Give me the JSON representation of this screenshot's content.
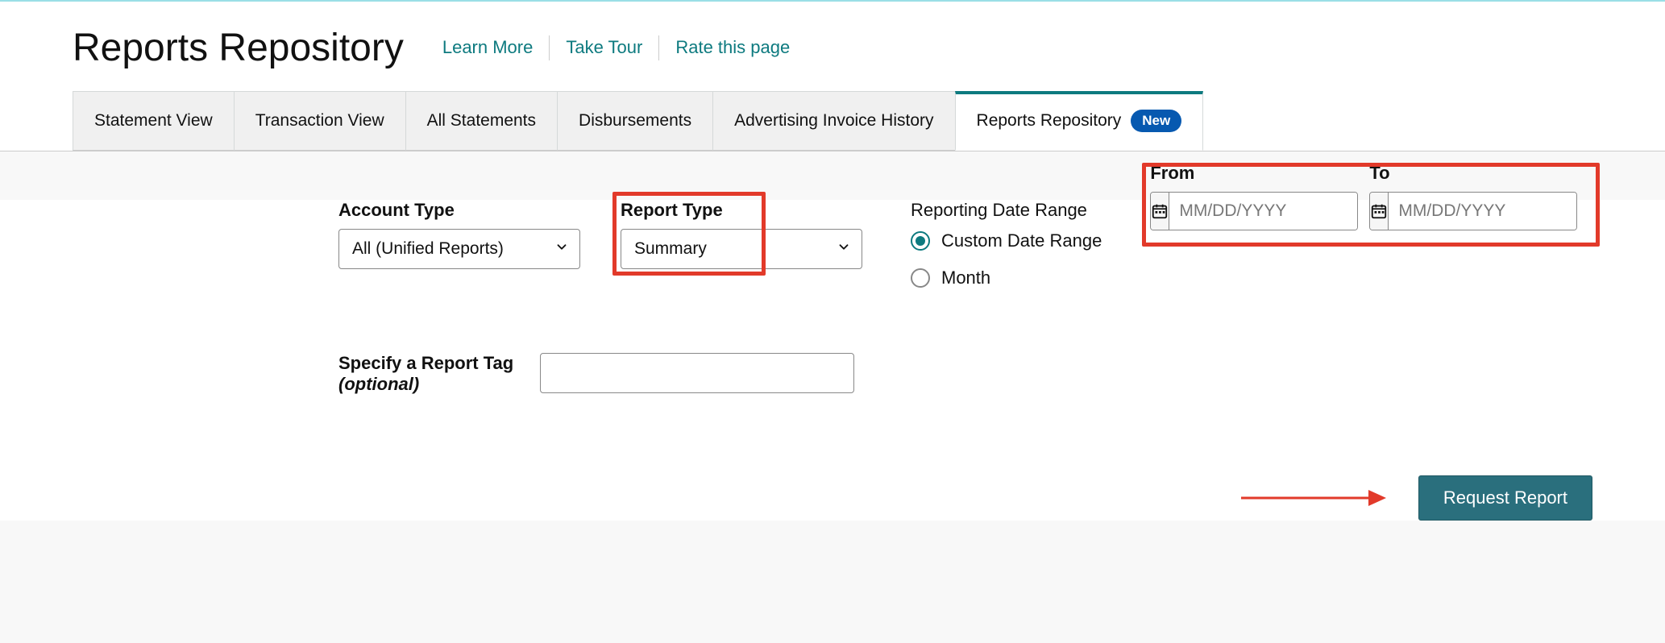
{
  "header": {
    "title": "Reports Repository",
    "links": [
      "Learn More",
      "Take Tour",
      "Rate this page"
    ]
  },
  "tabs": [
    {
      "label": "Statement View",
      "active": false
    },
    {
      "label": "Transaction View",
      "active": false
    },
    {
      "label": "All Statements",
      "active": false
    },
    {
      "label": "Disbursements",
      "active": false
    },
    {
      "label": "Advertising Invoice History",
      "active": false
    },
    {
      "label": "Reports Repository",
      "active": true,
      "badge": "New"
    }
  ],
  "form": {
    "account_type": {
      "label": "Account Type",
      "value": "All (Unified Reports)"
    },
    "report_type": {
      "label": "Report Type",
      "value": "Summary"
    },
    "reporting_range": {
      "label": "Reporting Date Range",
      "options": [
        {
          "label": "Custom Date Range",
          "checked": true
        },
        {
          "label": "Month",
          "checked": false
        }
      ]
    },
    "date_from": {
      "label": "From",
      "placeholder": "MM/DD/YYYY",
      "value": ""
    },
    "date_to": {
      "label": "To",
      "placeholder": "MM/DD/YYYY",
      "value": ""
    },
    "report_tag": {
      "label": "Specify a Report Tag",
      "optional": "(optional)",
      "value": ""
    }
  },
  "actions": {
    "request_report": "Request Report"
  },
  "icons": {
    "chevron_down": "chevron-down-icon",
    "calendar": "calendar-icon"
  },
  "annotations": {
    "highlight_report_type": true,
    "highlight_date_range": true,
    "arrow_to_request": true
  }
}
